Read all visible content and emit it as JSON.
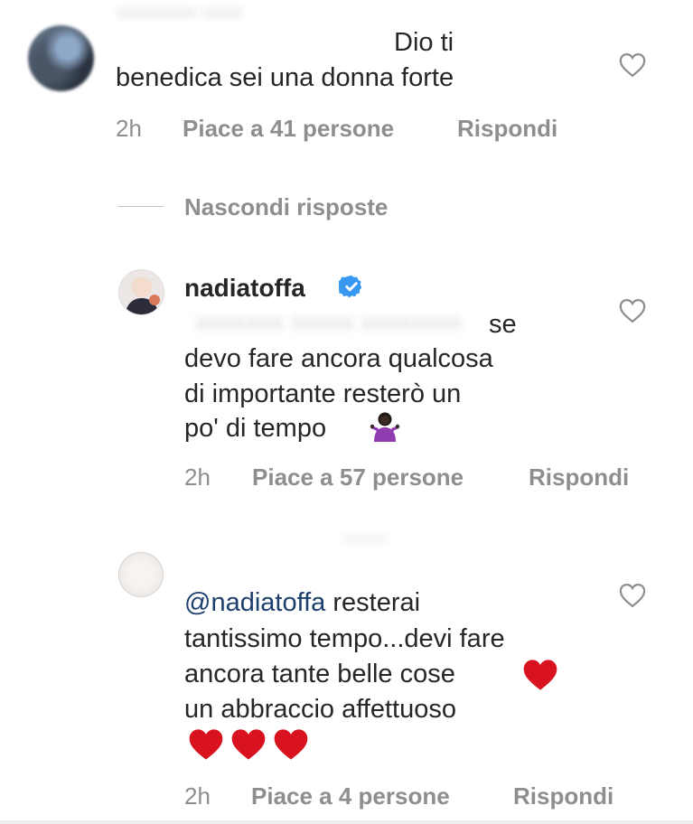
{
  "comments": [
    {
      "text_line1": "Dio ti",
      "text_line2": "benedica sei una donna forte",
      "time": "2h",
      "likes": "Piace a 41 persone",
      "reply_label": "Rispondi"
    }
  ],
  "replies_toggle": "Nascondi risposte",
  "reply1": {
    "username": "nadiatoffa",
    "verified_icon": "verified-badge-icon",
    "lines": [
      "se",
      "devo fare ancora qualcosa",
      "di importante resterò  un",
      "po' di tempo"
    ],
    "emoji": "woman-shrugging-emoji",
    "time": "2h",
    "likes": "Piace a 57 persone",
    "reply_label": "Rispondi"
  },
  "reply2": {
    "mention": "@nadiatoffa",
    "line1_rest": " resterai",
    "lines": [
      "tantissimo tempo...devi fare",
      "ancora tante belle cose",
      "un abbraccio affettuoso"
    ],
    "emoji": "red-heart-emoji",
    "time": "2h",
    "likes": "Piace a 4 persone",
    "reply_label": "Rispondi"
  },
  "colors": {
    "text": "#262626",
    "meta": "#8e8e8e",
    "verified": "#3897f0",
    "heart_emoji": "#d9121f",
    "mention": "#1c3f6e"
  }
}
